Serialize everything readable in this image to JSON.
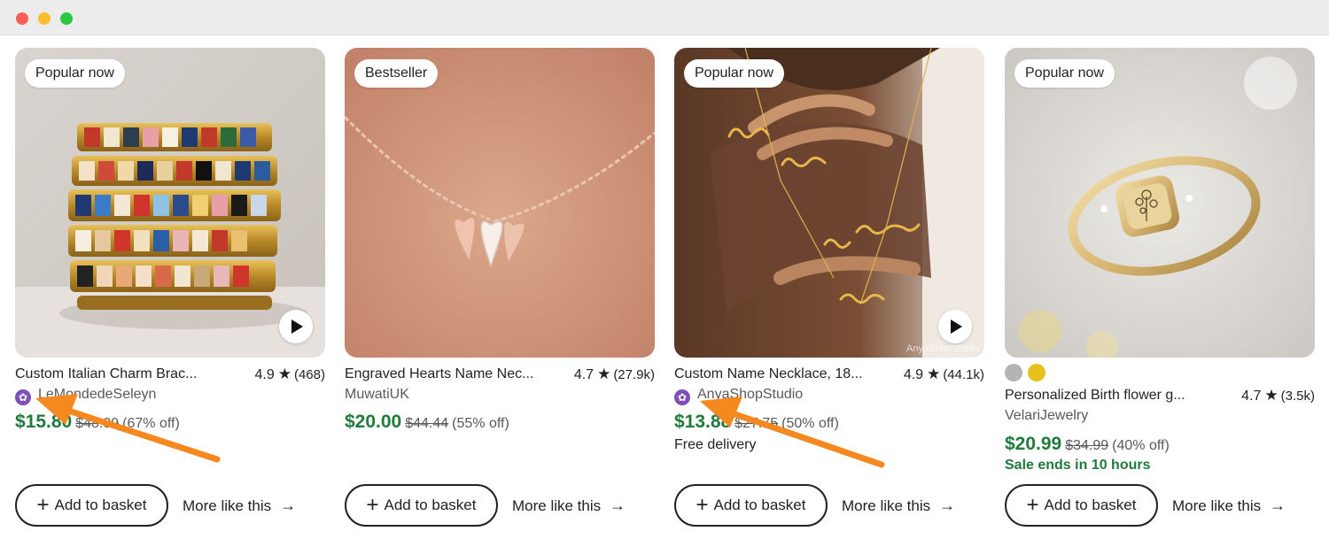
{
  "window": {
    "controls": [
      "close",
      "minimize",
      "maximize"
    ]
  },
  "actions": {
    "add_label": "Add to basket",
    "more_label": "More like this"
  },
  "icons": {
    "star": "★",
    "plus": "+",
    "arrow": "→",
    "play": "play-icon",
    "star_seller": "star-seller-icon"
  },
  "colors": {
    "price_green": "#1f7a3b",
    "star_seller_purple": "#7f4fb9",
    "annotation_arrow": "#f5891f"
  },
  "products": [
    {
      "badge": "Popular now",
      "title": "Custom Italian Charm Brac...",
      "rating": "4.9",
      "reviews": "(468)",
      "shop": "LeMondedeSeleyn",
      "price": "$15.80",
      "original_price": "$48.09",
      "discount": "(67% off)",
      "has_video": true
    },
    {
      "badge": "Bestseller",
      "title": "Engraved Hearts Name Nec...",
      "rating": "4.7",
      "reviews": "(27.9k)",
      "shop": "MuwatiUK",
      "price": "$20.00",
      "original_price": "$44.44",
      "discount": "(55% off)",
      "has_video": false
    },
    {
      "badge": "Popular now",
      "title": "Custom Name Necklace, 18...",
      "rating": "4.9",
      "reviews": "(44.1k)",
      "shop": "AnyaShopStudio",
      "price": "$13.88",
      "original_price": "$27.75",
      "discount": "(50% off)",
      "delivery": "Free delivery",
      "watermark": "AnyaShopStudio",
      "has_video": true
    },
    {
      "badge": "Popular now",
      "title": "Personalized Birth flower g...",
      "rating": "4.7",
      "reviews": "(3.5k)",
      "shop": "VelariJewelry",
      "price": "$20.99",
      "original_price": "$34.99",
      "discount": "(40% off)",
      "sale_note": "Sale ends in 10 hours",
      "swatches": [
        "#b4b4b4",
        "#e6c21e"
      ],
      "has_video": false
    }
  ]
}
